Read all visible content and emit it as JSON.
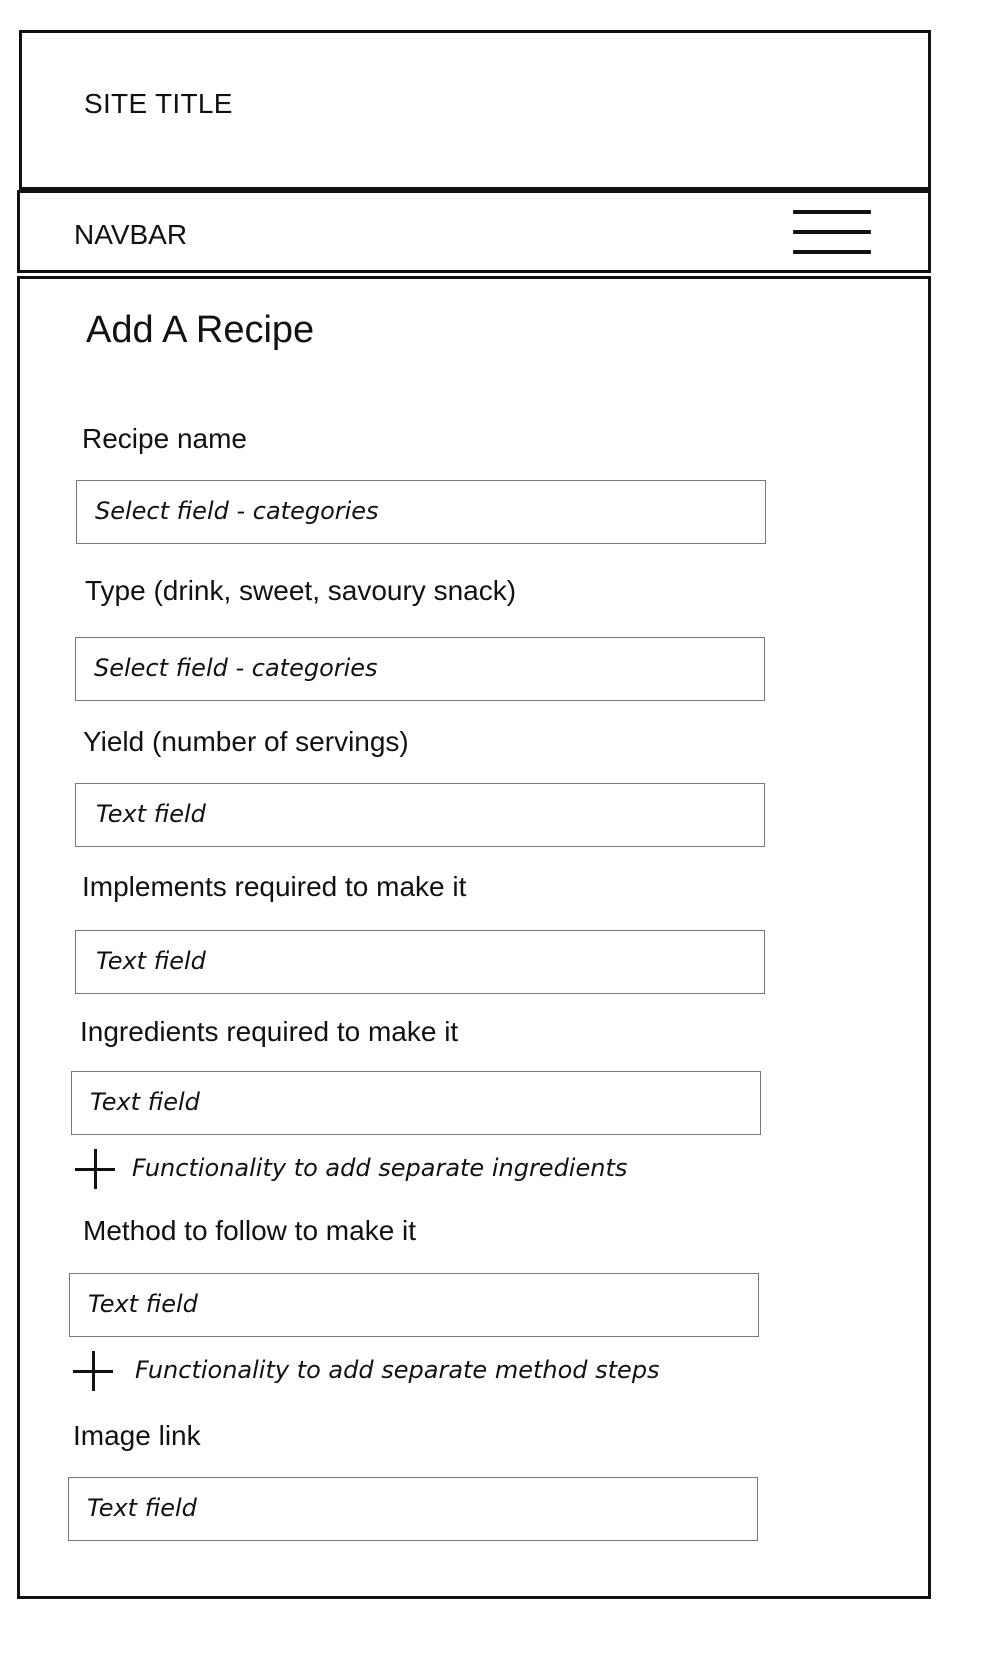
{
  "header": {
    "site_title": "SITE TITLE"
  },
  "navbar": {
    "label": "NAVBAR",
    "menu_icon": "hamburger-menu-icon"
  },
  "form": {
    "title": "Add A Recipe",
    "fields": [
      {
        "label": "Recipe name",
        "placeholder": "Select field - categories"
      },
      {
        "label": "Type (drink, sweet, savoury snack)",
        "placeholder": "Select field - categories"
      },
      {
        "label": "Yield (number of servings)",
        "placeholder": "Text field"
      },
      {
        "label": "Implements required to make it",
        "placeholder": "Text field"
      },
      {
        "label": "Ingredients required to make it",
        "placeholder": "Text field"
      },
      {
        "label": "Method to follow to make it",
        "placeholder": "Text field"
      },
      {
        "label": "Image link",
        "placeholder": "Text field"
      }
    ],
    "add_ingredients": {
      "icon": "plus-icon",
      "label": "Functionality to add separate ingredients"
    },
    "add_method_steps": {
      "icon": "plus-icon",
      "label": "Functionality to add separate method steps"
    }
  }
}
